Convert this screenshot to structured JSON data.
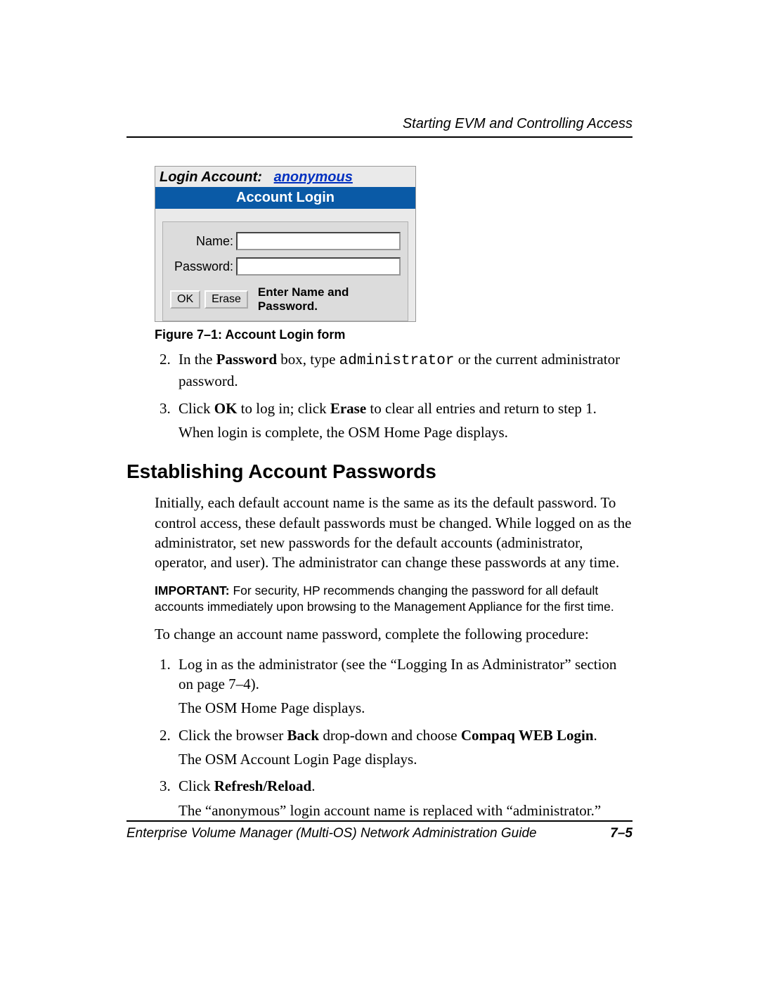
{
  "header": {
    "running_head": "Starting EVM and Controlling Access"
  },
  "figure": {
    "login_account_label": "Login Account:",
    "login_account_value": "anonymous",
    "bar_title": "Account Login",
    "name_label": "Name:",
    "password_label": "Password:",
    "ok_button": "OK",
    "erase_button": "Erase",
    "prompt": "Enter Name and Password.",
    "caption": "Figure 7–1:  Account Login form"
  },
  "steps_a": {
    "item2_pre": "In the ",
    "item2_bold1": "Password",
    "item2_mid": " box, type  ",
    "item2_code": "administrator",
    "item2_post": "  or the current administrator password.",
    "item3_pre": "Click ",
    "item3_bold1": "OK",
    "item3_mid": " to log in; click ",
    "item3_bold2": "Erase",
    "item3_post": " to clear all entries and return to step 1.",
    "item3_after": "When login is complete, the OSM Home Page displays."
  },
  "section": {
    "title": "Establishing Account Passwords",
    "para1": "Initially, each default account name is the same as its the default password. To control access, these default passwords must be changed. While logged on as the administrator, set new passwords for the default accounts (administrator, operator, and user). The administrator can change these passwords at any time.",
    "note_label": "IMPORTANT:",
    "note_body": "  For security, HP recommends changing the password for all default accounts immediately upon browsing to the Management Appliance for the first time.",
    "para2": "To change an account name password, complete the following procedure:"
  },
  "steps_b": {
    "item1": "Log in as the administrator (see the “Logging In as Administrator” section on page 7–4).",
    "item1_after": "The OSM Home Page displays.",
    "item2_pre": "Click the browser ",
    "item2_bold1": "Back",
    "item2_mid": " drop-down and choose ",
    "item2_bold2": "Compaq WEB Login",
    "item2_post": ".",
    "item2_after": "The OSM Account Login Page displays.",
    "item3_pre": "Click ",
    "item3_bold1": "Refresh/Reload",
    "item3_post": ".",
    "item3_after": "The “anonymous” login account name is replaced with “administrator.”"
  },
  "footer": {
    "book": "Enterprise Volume Manager (Multi-OS) Network Administration Guide",
    "pagenum": "7–5"
  }
}
